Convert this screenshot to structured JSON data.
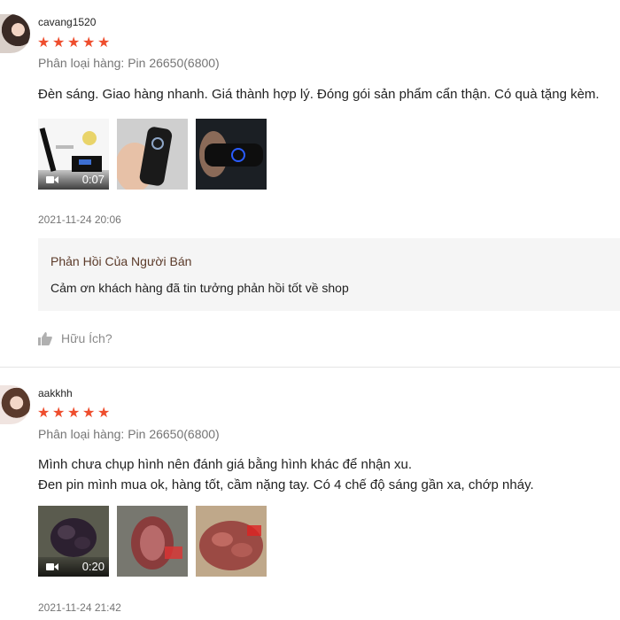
{
  "reviews": [
    {
      "username": "cavang1520",
      "rating": 5,
      "variant": "Phân loại hàng: Pin 26650(6800)",
      "comment": "Đèn sáng. Giao hàng nhanh. Giá thành hợp lý. Đóng gói sản phẩm cẩn thận. Có quà tặng kèm.",
      "media": [
        {
          "type": "video",
          "duration": "0:07"
        },
        {
          "type": "image"
        },
        {
          "type": "image"
        }
      ],
      "date": "2021-11-24 20:06",
      "seller_reply": {
        "title": "Phản Hồi Của Người Bán",
        "text": "Cảm ơn khách hàng đã tin tưởng phản hồi tốt về shop"
      },
      "helpful_label": "Hữu Ích?"
    },
    {
      "username": "aakkhh",
      "rating": 5,
      "variant": "Phân loại hàng: Pin 26650(6800)",
      "comment": "Mình chưa chụp hình nên đánh giá bằng hình khác để nhận xu.\nĐen pin mình mua ok, hàng tốt, cầm nặng tay. Có 4 chế độ sáng gần xa, chớp nháy.",
      "media": [
        {
          "type": "video",
          "duration": "0:20"
        },
        {
          "type": "image"
        },
        {
          "type": "image"
        }
      ],
      "date": "2021-11-24 21:42"
    }
  ],
  "icons": {
    "star": "star-icon",
    "thumb": "thumbs-up-icon",
    "video": "video-camera-icon"
  },
  "colors": {
    "star": "#ee4d2d",
    "muted": "#757575",
    "seller_bg": "#f5f5f5"
  }
}
